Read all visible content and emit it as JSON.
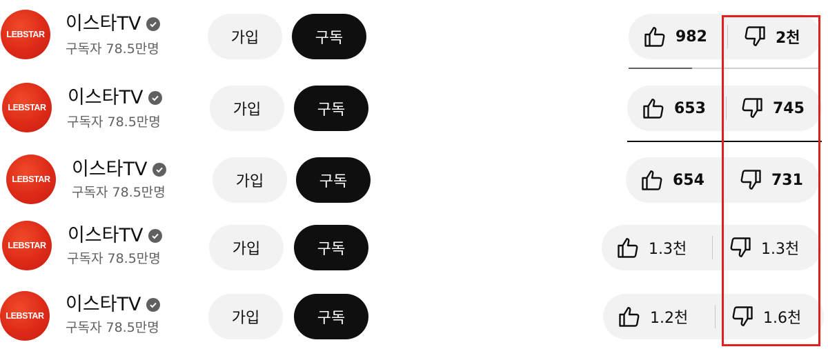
{
  "channel": {
    "name": "이스타TV",
    "subscribers": "구독자 78.5만명",
    "logo_text": "LEBSTAR",
    "logo_color": "#dd2a18"
  },
  "buttons": {
    "join_label": "가입",
    "subscribe_label": "구독"
  },
  "icons": {
    "like": "thumb-up-icon",
    "dislike": "thumb-down-icon",
    "verified": "verified-check-icon"
  },
  "rows": [
    {
      "likes": "982",
      "dislikes": "2천",
      "like_ratio_shown": 0.33
    },
    {
      "likes": "653",
      "dislikes": "745",
      "like_ratio_shown": 1.0
    },
    {
      "likes": "654",
      "dislikes": "731"
    },
    {
      "likes": "1.3천",
      "dislikes": "1.3천"
    },
    {
      "likes": "1.2천",
      "dislikes": "1.6천"
    }
  ],
  "highlight_color": "#e0201c"
}
